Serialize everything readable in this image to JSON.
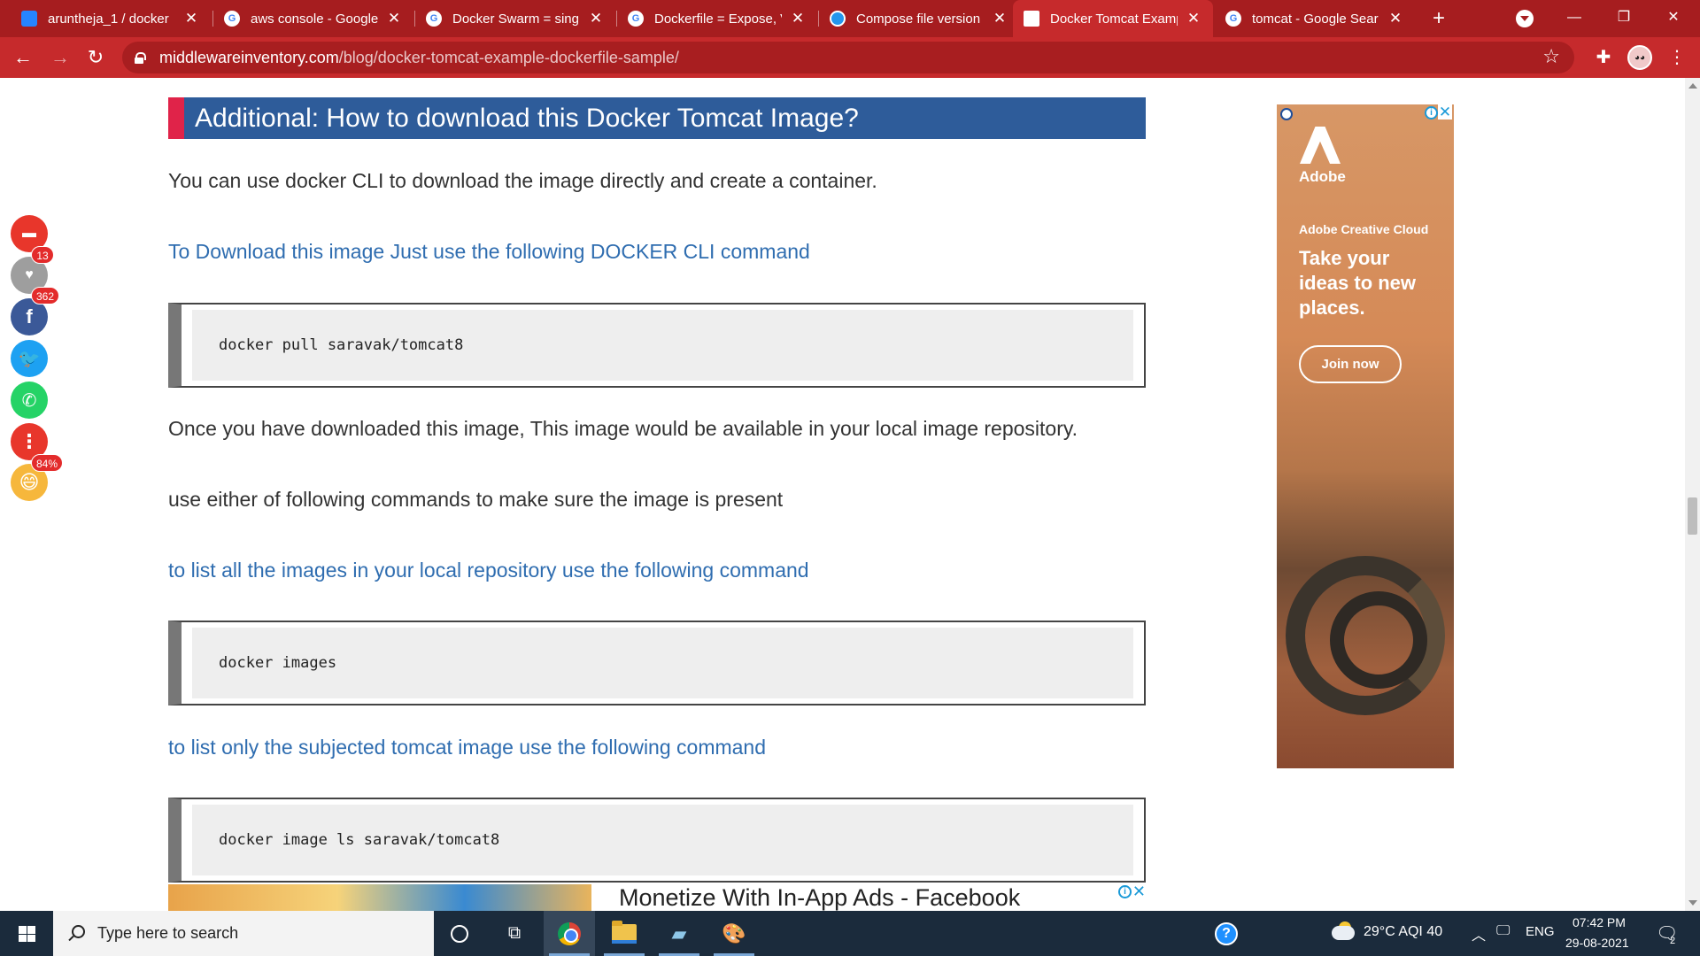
{
  "tabs": [
    {
      "title": "aruntheja_1 / docker",
      "favicon": "bitbucket-icon",
      "color": "#2684ff",
      "active": false
    },
    {
      "title": "aws console - Google",
      "favicon": "google-icon",
      "color": "#ffffff",
      "active": false
    },
    {
      "title": "Docker Swarm = single",
      "favicon": "google-icon",
      "color": "#ffffff",
      "active": false
    },
    {
      "title": "Dockerfile = Expose, V",
      "favicon": "google-icon",
      "color": "#ffffff",
      "active": false
    },
    {
      "title": "Compose file version",
      "favicon": "docker-icon",
      "color": "#2496ed",
      "active": false
    },
    {
      "title": "Docker Tomcat Examp",
      "favicon": "middleware-inventory-icon",
      "color": "#ffffff",
      "active": true
    },
    {
      "title": "tomcat - Google Sear",
      "favicon": "google-icon",
      "color": "#ffffff",
      "active": false
    }
  ],
  "address": {
    "host": "middlewareinventory.com",
    "path": "/blog/docker-tomcat-example-dockerfile-sample/"
  },
  "article": {
    "heading": "Additional: How to download this Docker Tomcat Image?",
    "p1": "You can use docker CLI to download the image directly and create a container.",
    "p2": "To Download this image Just use the following DOCKER CLI command",
    "code1": "docker pull saravak/tomcat8",
    "p3": "Once you have downloaded this image, This image would be available in your local image repository.",
    "p4": "use either of following commands to make sure the image is present",
    "p5": "to list all the images in your local repository use the following command",
    "code2": "docker images",
    "p6": "to list only the subjected tomcat image use the following command",
    "code3": "docker image ls saravak/tomcat8"
  },
  "bottom_ad": {
    "text": "Monetize With In-App Ads - Facebook"
  },
  "side_ad": {
    "brand": "Adobe",
    "product": "Adobe Creative Cloud",
    "tagline": "Take your ideas to new places.",
    "cta": "Join now"
  },
  "share": {
    "likes": "13",
    "facebook": "362",
    "reaction": "84%"
  },
  "taskbar": {
    "search_placeholder": "Type here to search",
    "weather": "29°C  AQI 40",
    "language": "ENG",
    "time": "07:42 PM",
    "date": "29-08-2021",
    "notifications": "2"
  }
}
